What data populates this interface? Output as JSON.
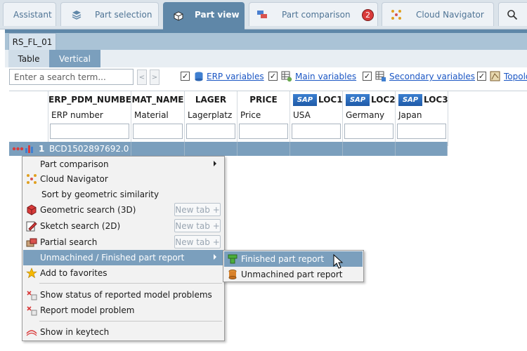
{
  "tabs": [
    {
      "label": "Assistant",
      "icon": "assistant-icon"
    },
    {
      "label": "Part selection",
      "icon": "stack-icon"
    },
    {
      "label": "Part view",
      "icon": "cube-icon",
      "active": true
    },
    {
      "label": "Part comparison",
      "icon": "compare-icon",
      "badge": "2"
    },
    {
      "label": "Cloud Navigator",
      "icon": "cloud-navigator-icon"
    },
    {
      "label": "",
      "icon": "search-icon"
    }
  ],
  "subtabs": {
    "rs": "RS_FL_01",
    "table": "Table",
    "vertical": "Vertical"
  },
  "toolbar": {
    "search_placeholder": "Enter a search term...",
    "prev": "<",
    "next": ">",
    "erp_variables": "ERP variables",
    "main_variables": "Main variables",
    "secondary_variables": "Secondary variables",
    "topology": "Topolo"
  },
  "columns": [
    {
      "name": "ERP_PDM_NUMBER",
      "sub": "ERP number",
      "sap": false
    },
    {
      "name": "MAT_NAME",
      "sub": "Material",
      "sap": false
    },
    {
      "name": "LAGER",
      "sub": "Lagerplatz",
      "sap": false
    },
    {
      "name": "PRICE",
      "sub": "Price",
      "sap": false
    },
    {
      "name": "LOC1",
      "sub": "USA",
      "sap": true
    },
    {
      "name": "LOC2",
      "sub": "Germany",
      "sap": true
    },
    {
      "name": "LOC3",
      "sub": "Japan",
      "sap": true
    }
  ],
  "sap_label": "SAP",
  "row": {
    "index": "1",
    "erp_number": "BCD1502897692.0"
  },
  "menu": {
    "part_comparison": "Part comparison",
    "cloud_navigator": "Cloud Navigator",
    "sort_geometric": "Sort by geometric similarity",
    "geometric_search": "Geometric search (3D)",
    "sketch_search": "Sketch search (2D)",
    "partial_search": "Partial search",
    "new_tab": "New tab +",
    "unmachined_report": "Unmachined / Finished part report",
    "add_favorites": "Add to favorites",
    "show_status": "Show status of reported model problems",
    "report_problem": "Report model problem",
    "show_keytech": "Show in keytech"
  },
  "submenu": {
    "finished": "Finished part report",
    "unmachined": "Unmachined part report"
  },
  "colors": {
    "accent": "#5f87a8",
    "highlight": "#7b9fbd",
    "link": "#1a56c4"
  }
}
